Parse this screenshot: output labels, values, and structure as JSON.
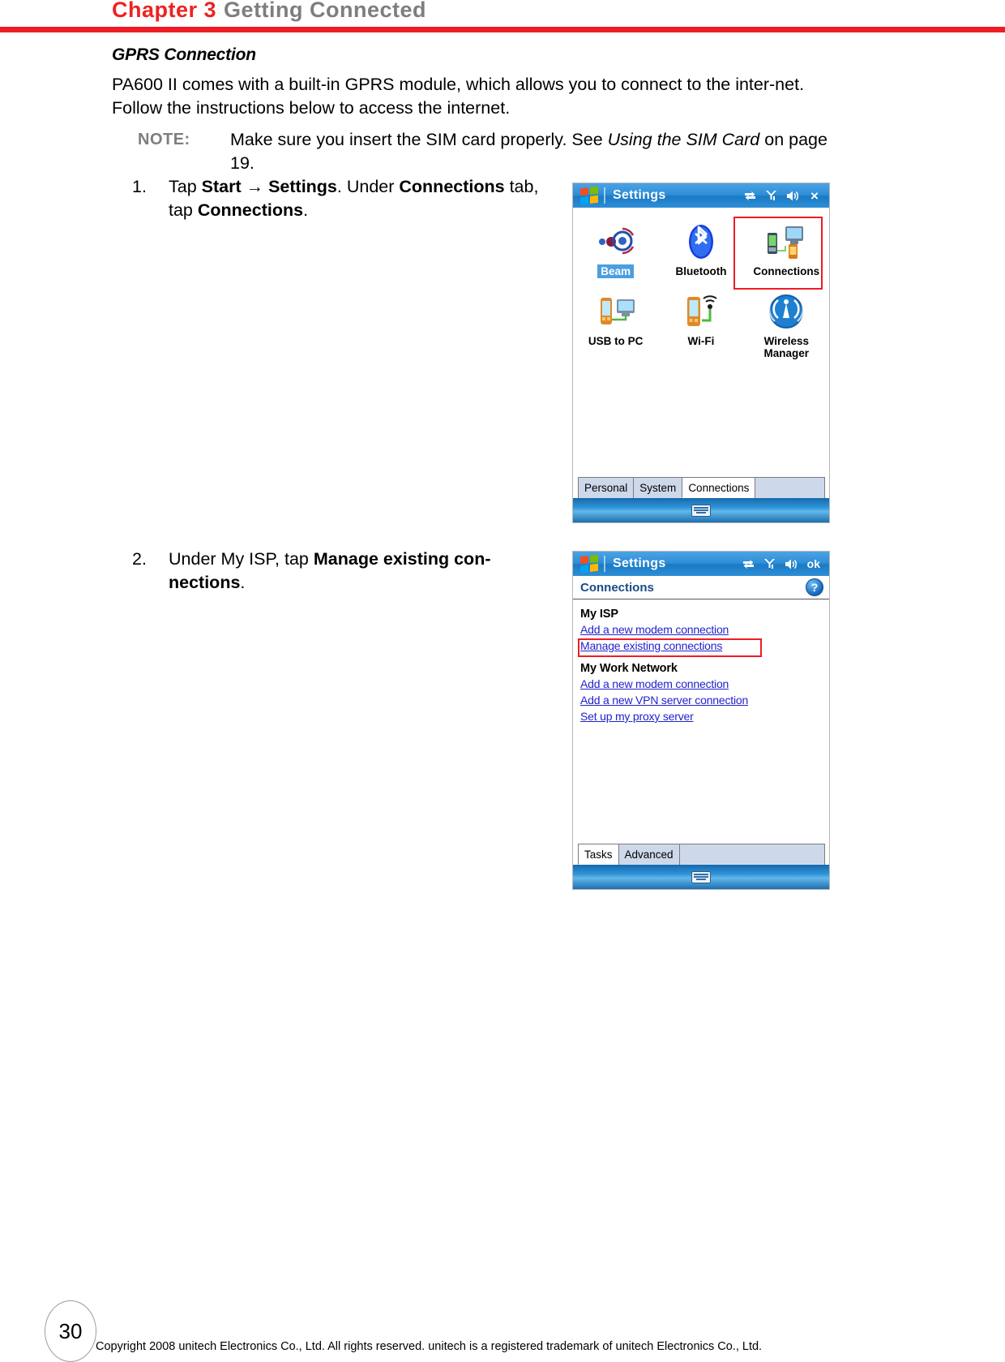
{
  "header": {
    "chapter_number": "Chapter 3",
    "chapter_name": "Getting Connected",
    "rule_color": "#ee1c25",
    "chapter_number_color": "#ee2222",
    "chapter_name_color": "#7e7e7e"
  },
  "section": {
    "heading": "GPRS Connection",
    "intro": "PA600 II comes with a built-in GPRS module, which allows you to connect to the inter-net. Follow the instructions below to access the internet.",
    "note": {
      "label": "NOTE:",
      "text_before": "Make sure you insert the SIM card properly. See ",
      "text_italic": "Using the SIM Card",
      "text_after": " on page 19."
    }
  },
  "steps": [
    {
      "number": "1.",
      "text_parts": [
        "Tap ",
        "Start",
        " → ",
        "Settings",
        ". Under ",
        "Connections",
        " tab, tap ",
        "Connections",
        "."
      ]
    },
    {
      "number": "2.",
      "text_parts": [
        "Under My ISP, tap ",
        "Manage existing con-nections",
        "."
      ]
    }
  ],
  "screenshot1": {
    "titlebar": {
      "title": "Settings",
      "icons": [
        "windows-logo",
        "connectivity-icon",
        "signal-icon",
        "speaker-icon",
        "close-icon"
      ],
      "close_label": "×"
    },
    "icons": [
      {
        "label": "Beam",
        "icon": "beam-icon",
        "selected": true
      },
      {
        "label": "Bluetooth",
        "icon": "bluetooth-icon",
        "selected": false
      },
      {
        "label": "Connections",
        "icon": "connections-icon",
        "selected": false,
        "highlighted": true
      },
      {
        "label": "USB to PC",
        "icon": "usb-to-pc-icon",
        "selected": false
      },
      {
        "label": "Wi-Fi",
        "icon": "wifi-icon",
        "selected": false
      },
      {
        "label": "Wireless Manager",
        "icon": "wireless-manager-icon",
        "selected": false
      }
    ],
    "tabs": [
      {
        "label": "Personal",
        "active": false
      },
      {
        "label": "System",
        "active": false
      },
      {
        "label": "Connections",
        "active": true
      }
    ],
    "sip": {
      "icon": "keyboard-icon"
    },
    "highlight_color": "#ee1c25"
  },
  "screenshot2": {
    "titlebar": {
      "title": "Settings",
      "icons": [
        "windows-logo",
        "connectivity-icon",
        "signal-icon",
        "speaker-icon",
        "ok-button"
      ],
      "ok_label": "ok"
    },
    "page_title": "Connections",
    "help_label": "?",
    "groups": [
      {
        "title": "My ISP",
        "links": [
          {
            "label": "Add a new modem connection",
            "highlighted": false
          },
          {
            "label": "Manage existing connections",
            "highlighted": true
          }
        ]
      },
      {
        "title": "My Work Network",
        "links": [
          {
            "label": "Add a new modem connection",
            "highlighted": false
          },
          {
            "label": "Add a new VPN server connection",
            "highlighted": false
          },
          {
            "label": "Set up my proxy server",
            "highlighted": false
          }
        ]
      }
    ],
    "tabs": [
      {
        "label": "Tasks",
        "active": true
      },
      {
        "label": "Advanced",
        "active": false
      }
    ],
    "sip": {
      "icon": "keyboard-icon"
    },
    "highlight_color": "#ee1c25"
  },
  "footer": {
    "page_number": "30",
    "copyright": "Copyright 2008 unitech Electronics Co., Ltd. All rights reserved. unitech is a registered trademark of unitech Electronics Co., Ltd."
  }
}
